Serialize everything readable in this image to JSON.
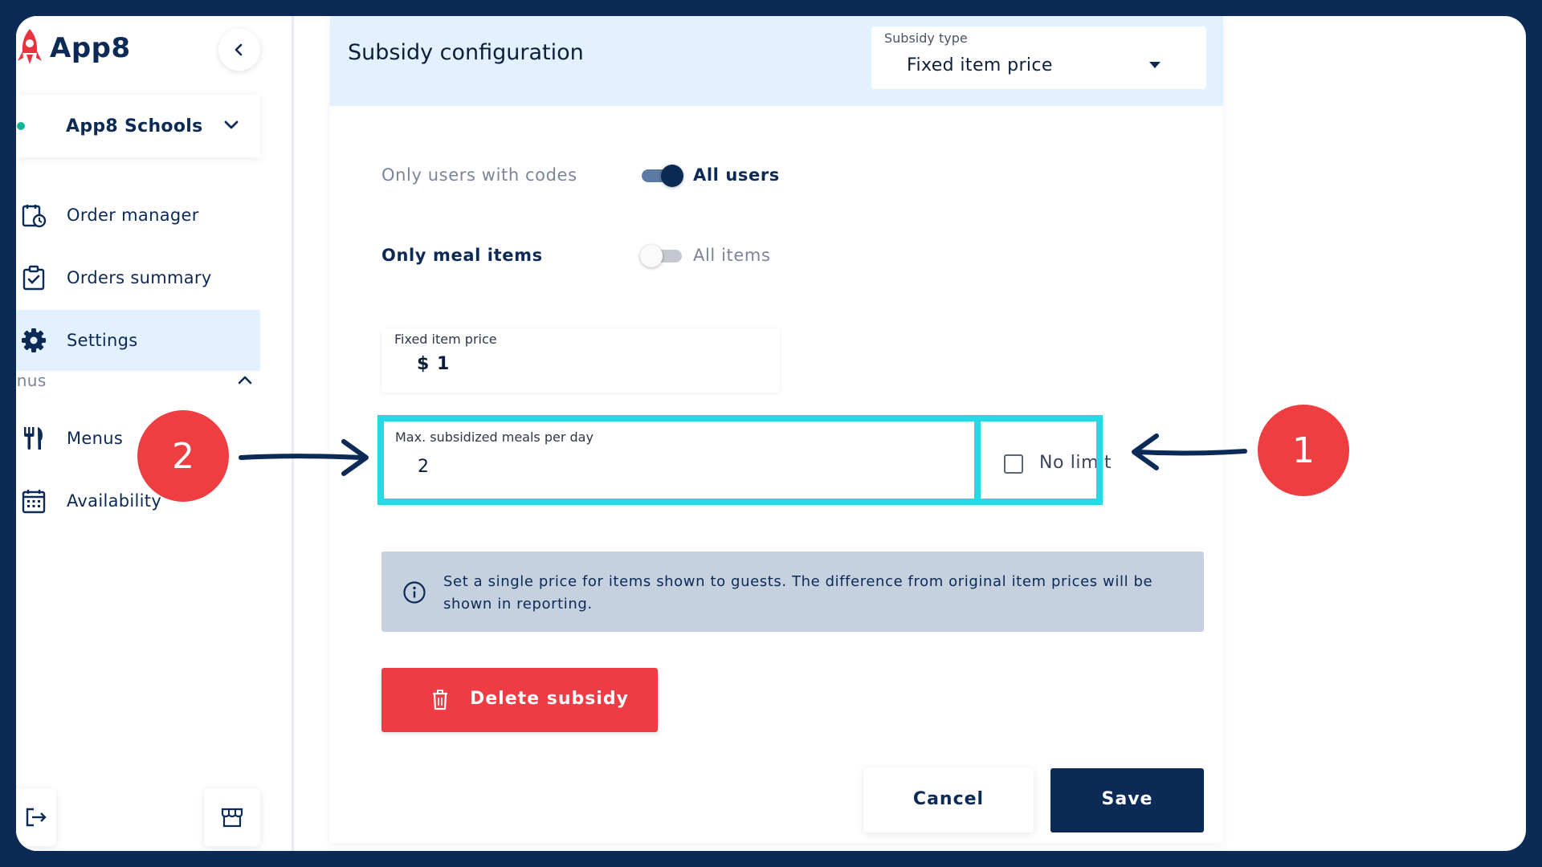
{
  "app": {
    "name": "App8"
  },
  "sidebar": {
    "school": "App8 Schools",
    "items": [
      {
        "label": "Order manager"
      },
      {
        "label": "Orders summary"
      },
      {
        "label": "Settings"
      }
    ],
    "section": {
      "label": "enus"
    },
    "menu_items": [
      {
        "label": "Menus"
      },
      {
        "label": "Availability"
      }
    ]
  },
  "main": {
    "title": "Subsidy configuration",
    "subsidy_type": {
      "label": "Subsidy type",
      "value": "Fixed item price"
    },
    "toggles": [
      {
        "left": "Only users with codes",
        "right": "All users",
        "on": true
      },
      {
        "left": "Only meal items",
        "right": "All items",
        "on": false
      }
    ],
    "fixed_price": {
      "label": "Fixed item price",
      "value": "$ 1"
    },
    "max_meals": {
      "label": "Max. subsidized meals per day",
      "value": "2"
    },
    "no_limit": {
      "label": "No limit",
      "checked": false
    },
    "info": "Set a single price for items shown to guests. The difference from original item prices will be shown in reporting.",
    "delete_label": "Delete subsidy",
    "cancel_label": "Cancel",
    "save_label": "Save"
  },
  "callouts": {
    "one": "1",
    "two": "2"
  },
  "colors": {
    "primary": "#0b2a55",
    "accent_light": "#e3f0fd",
    "danger": "#ee3b44",
    "highlight": "#27d8e6",
    "callout": "#ef3e42"
  }
}
